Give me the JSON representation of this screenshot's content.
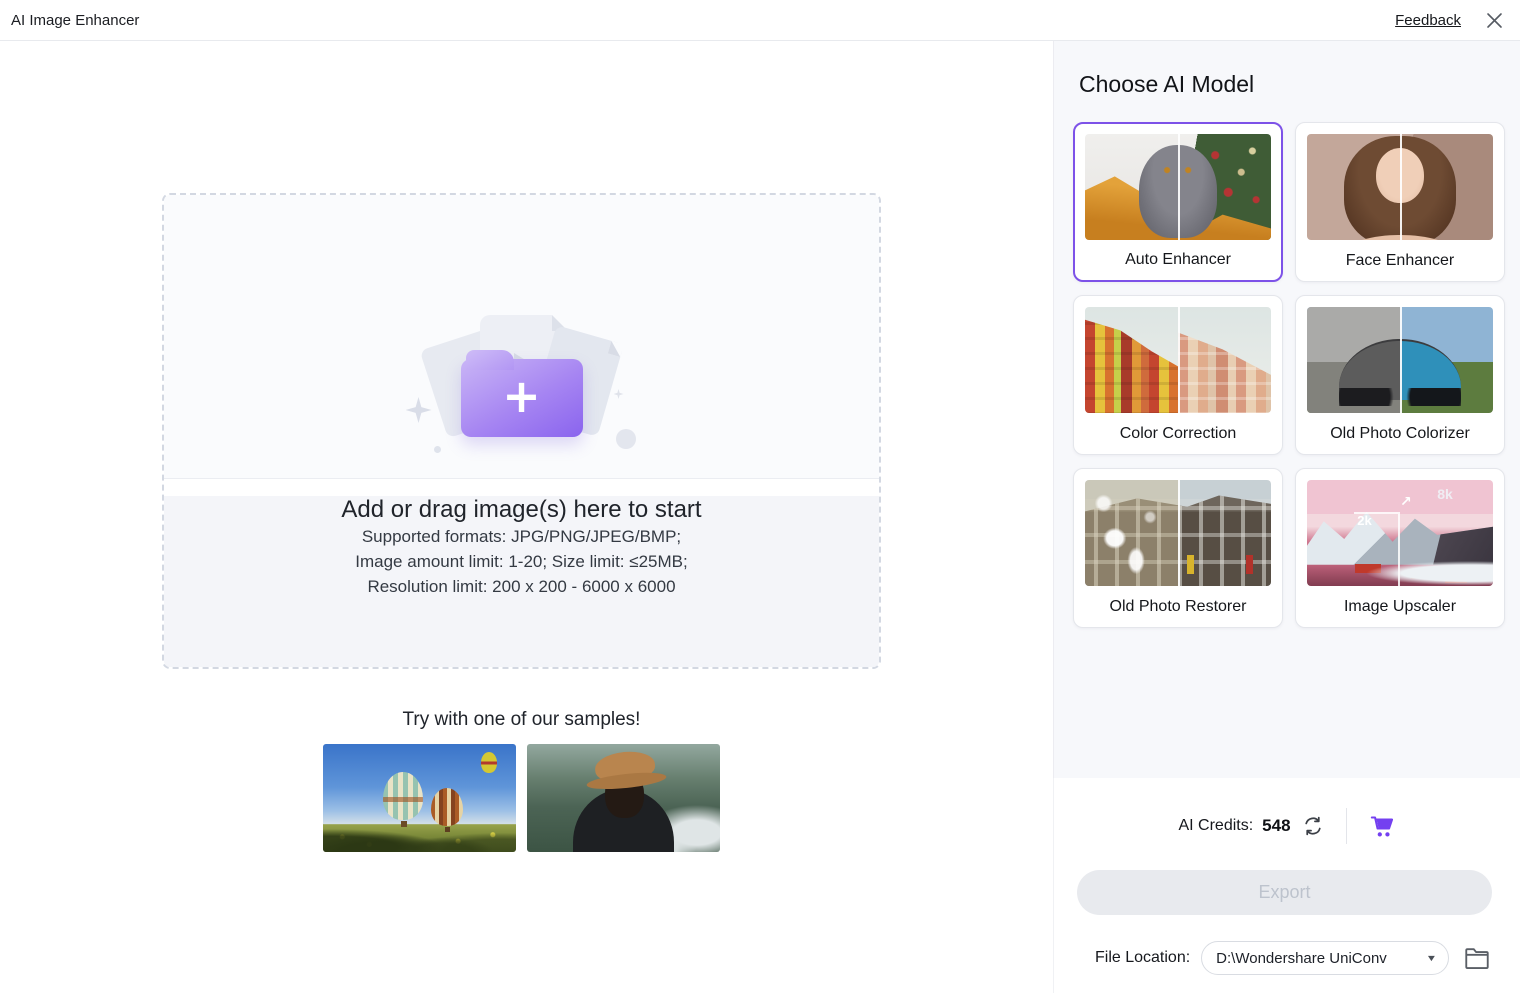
{
  "window": {
    "title": "AI Image Enhancer"
  },
  "header": {
    "feedback": "Feedback"
  },
  "dropzone": {
    "title": "Add or drag image(s) here to start",
    "formats": "Supported formats: JPG/PNG/JPEG/BMP;",
    "limits": "Image amount limit: 1-20; Size limit: ≤25MB;",
    "resolution": "Resolution limit: 200 x 200 - 6000 x 6000"
  },
  "samples": {
    "title": "Try with one of our samples!",
    "items": [
      {
        "name": "hot-air-balloons"
      },
      {
        "name": "woman-with-hat"
      }
    ]
  },
  "model_panel": {
    "title": "Choose AI Model",
    "models": [
      {
        "label": "Auto Enhancer",
        "selected": true
      },
      {
        "label": "Face Enhancer",
        "selected": false
      },
      {
        "label": "Color Correction",
        "selected": false
      },
      {
        "label": "Old Photo Colorizer",
        "selected": false
      },
      {
        "label": "Old Photo Restorer",
        "selected": false
      },
      {
        "label": "Image Upscaler",
        "selected": false,
        "badge_small": "2k",
        "badge_large": "8k"
      }
    ]
  },
  "footer": {
    "credits_label": "AI Credits:",
    "credits_value": "548",
    "export_label": "Export",
    "file_location_label": "File Location:",
    "file_location_value": "D:\\Wondershare UniConv"
  },
  "icons": {
    "close": "✕",
    "caret_down": "▼",
    "arrow_up_right": "↗",
    "plus": "+"
  },
  "colors": {
    "accent_purple": "#7d52e8",
    "cart_purple": "#7440f0",
    "panel_bg": "#f7f8fb",
    "dropzone_bg": "#f4f5f9",
    "export_disabled_bg": "#e8eaee"
  }
}
